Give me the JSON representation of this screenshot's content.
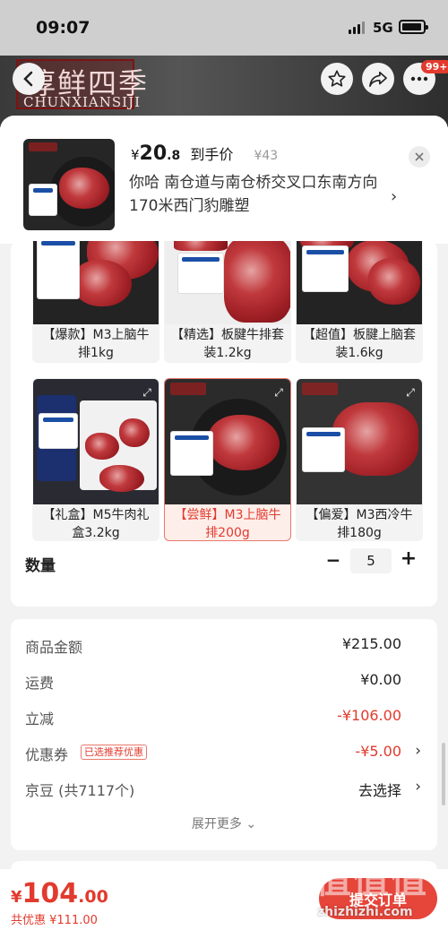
{
  "status_bar": {
    "time": "09:07",
    "network": "5G"
  },
  "hero": {
    "brand_cn": "淳鲜四季",
    "brand_en": "CHUNXIANSIJI",
    "cart_badge": "99+"
  },
  "summary": {
    "price_yen": "¥",
    "price_int": "20",
    "price_dec": ".8",
    "price_label": "到手价",
    "original_price": "¥43",
    "address": "你哈  南仓道与南仓桥交叉口东南方向170米西门豹雕塑",
    "thumb_brand": "淳鲜四季"
  },
  "options": [
    {
      "label": "【爆款】M3上脑牛排1kg",
      "selected": false,
      "tag_line": "M3级"
    },
    {
      "label": "【精选】板腱牛排套装1.2kg",
      "selected": false,
      "tag_line": "谷饲安格斯"
    },
    {
      "label": "【超值】板腱上脑套装1.6kg",
      "selected": false,
      "tag_line": "谷饲安格斯"
    },
    {
      "label": "【礼盒】M5牛肉礼盒3.2kg",
      "selected": false,
      "tag_line": "PLUS会员专享"
    },
    {
      "label": "【尝鲜】M3上脑牛排200g",
      "selected": true,
      "tag_line": "谷饲安格斯"
    },
    {
      "label": "【偏爱】M3西冷牛排180g",
      "selected": false,
      "tag_line": "M3西冷牛排"
    }
  ],
  "option_brand": "淳鲜四季",
  "quantity": {
    "label": "数量",
    "minus": "−",
    "plus": "+",
    "value": "5"
  },
  "fees": {
    "goods_label": "商品金额",
    "goods_value": "¥215.00",
    "shipping_label": "运费",
    "shipping_value": "¥0.00",
    "discount_label": "立减",
    "discount_value": "-¥106.00",
    "coupon_label": "优惠券",
    "coupon_tag": "已选推荐优惠",
    "coupon_value": "-¥5.00",
    "jingdou_label": "京豆 (共7117个)",
    "jingdou_value": "去选择",
    "expand_more": "展开更多"
  },
  "bottom": {
    "total_yen": "¥",
    "total_int": "104",
    "total_dec": ".00",
    "saving": "共优惠 ¥111.00",
    "submit": "提交订单"
  },
  "watermark": {
    "text": "值值值",
    "url": "zhizhizhi.com"
  },
  "colors": {
    "accent": "#e23a2e",
    "submit_bg": "#e6453a",
    "tag_blue": "#1b4fa6"
  }
}
